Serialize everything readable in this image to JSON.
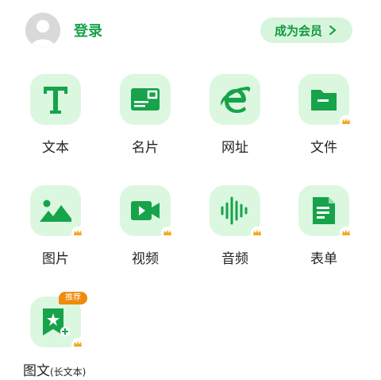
{
  "header": {
    "login_label": "登录",
    "vip_button_label": "成为会员"
  },
  "colors": {
    "accent": "#16a34a",
    "icon_bg": "#dbf7e0",
    "vip_bg": "#d6f5dc",
    "crown": "#f5a623",
    "badge": "#f08a0a"
  },
  "grid": {
    "items": [
      {
        "label": "文本",
        "icon": "text-T-icon",
        "premium": false
      },
      {
        "label": "名片",
        "icon": "business-card-icon",
        "premium": false
      },
      {
        "label": "网址",
        "icon": "browser-e-icon",
        "premium": false
      },
      {
        "label": "文件",
        "icon": "folder-icon",
        "premium": true
      },
      {
        "label": "图片",
        "icon": "image-icon",
        "premium": true
      },
      {
        "label": "视频",
        "icon": "video-camera-icon",
        "premium": true
      },
      {
        "label": "音频",
        "icon": "audio-waveform-icon",
        "premium": true
      },
      {
        "label": "表单",
        "icon": "form-document-icon",
        "premium": true
      }
    ],
    "long_text": {
      "label": "图文",
      "label_suffix": "(长文本)",
      "badge": "推荐",
      "icon": "bookmark-star-icon",
      "premium": true
    }
  }
}
